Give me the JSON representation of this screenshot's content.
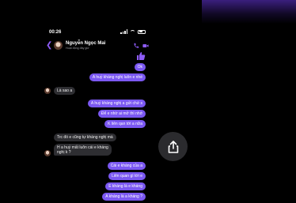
{
  "status": {
    "time": "00:26"
  },
  "header": {
    "name": "Nguyễn Ngọc Mai",
    "subtitle": "Hoạt động đây giờ"
  },
  "messages": [
    {
      "dir": "out",
      "text": "Ok"
    },
    {
      "dir": "out",
      "text": "A huỷ kháng nghị luôn e nhé"
    },
    {
      "dir": "in",
      "text": "Là sao a"
    },
    {
      "dir": "out",
      "text": "A huỷ kháng nghị a gửi chứ s"
    },
    {
      "dir": "out",
      "text": "Để e nhờ ai mở thì nhớ"
    },
    {
      "dir": "out",
      "text": "K liên qan tới a nữa"
    },
    {
      "dir": "in",
      "text": "Trc đó e cũng tự kháng nghị mà"
    },
    {
      "dir": "in",
      "text": "H a huỷ mất luôn cái e kháng"
    },
    {
      "dir": "in",
      "text": "nghị k ?"
    },
    {
      "dir": "out",
      "text": "Cái e kháng của a"
    },
    {
      "dir": "out",
      "text": "Liên quan gì tới e"
    },
    {
      "dir": "out",
      "text": "E kháng là e kháng"
    },
    {
      "dir": "out",
      "text": "A kháng là a kháng ?"
    }
  ],
  "colors": {
    "accent": "#7b58f2",
    "incoming": "#2e2e32"
  },
  "icons": {
    "back": "chevron-left-icon",
    "call": "phone-icon",
    "video": "video-icon",
    "sticker": "thumbs-up-icon",
    "share": "share-icon"
  }
}
